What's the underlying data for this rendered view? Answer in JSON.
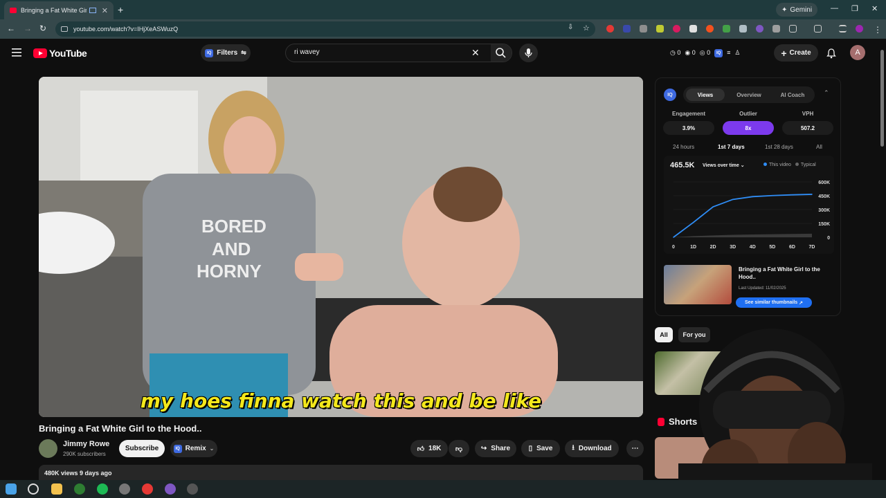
{
  "browser": {
    "tab_title": "Bringing a Fat White Girl to",
    "new_tab_icon": "plus-icon",
    "gemini_label": "Gemini",
    "url": "youtube.com/watch?v=IHjXeASWuzQ"
  },
  "youtube": {
    "logo_text": "YouTube",
    "filters_label": "Filters",
    "search_value": "ri wavey",
    "stats": [
      "0",
      "0",
      "0"
    ],
    "create_label": "Create",
    "avatar_letter": "A"
  },
  "video": {
    "caption": "my hoes finna watch this and be like",
    "title": "Bringing a Fat White Girl to the Hood..",
    "channel_name": "Jimmy Rowe",
    "subscribers": "290K subscribers",
    "subscribe_label": "Subscribe",
    "remix_label": "Remix",
    "likes": "18K",
    "share_label": "Share",
    "save_label": "Save",
    "download_label": "Download",
    "views_line": "480K views  9 days ago"
  },
  "iq_panel": {
    "logo_text": "IQ",
    "tabs": [
      "Views",
      "Overview",
      "AI Coach"
    ],
    "active_tab": "Views",
    "metrics": [
      {
        "label": "Engagement",
        "value": "3.9%"
      },
      {
        "label": "Outlier",
        "value": "8x"
      },
      {
        "label": "VPH",
        "value": "507.2"
      }
    ],
    "ranges": [
      "24 hours",
      "1st 7 days",
      "1st 28 days",
      "All"
    ],
    "active_range": "1st 7 days",
    "total_views": "465.5K",
    "chart_selector": "Views over time",
    "legend": [
      "This video",
      "Typical"
    ],
    "similar": {
      "title": "Bringing a Fat White Girl to the Hood..",
      "updated": "Last Updated: 11/02/2025",
      "button": "See similar thumbnails"
    }
  },
  "chart_data": {
    "type": "area",
    "x": [
      "0",
      "1D",
      "2D",
      "3D",
      "4D",
      "5D",
      "6D",
      "7D"
    ],
    "series": [
      {
        "name": "This video",
        "values": [
          0,
          160000,
          330000,
          410000,
          440000,
          452000,
          460000,
          465500
        ]
      },
      {
        "name": "Typical",
        "values": [
          0,
          12000,
          20000,
          26000,
          30000,
          33000,
          36000,
          38000
        ]
      }
    ],
    "y_ticks": [
      "0",
      "150K",
      "300K",
      "450K",
      "600K"
    ],
    "ylim": [
      0,
      600000
    ],
    "colors": {
      "this_video": "#2f8df6",
      "typical": "#555555"
    }
  },
  "sidebar": {
    "chips": [
      "All",
      "For you"
    ],
    "shorts_label": "Shorts"
  },
  "colors": {
    "accent": "#ff0033",
    "iq_blue": "#3e6ae1",
    "outlier_purple": "#7c3aed",
    "caption_yellow": "#f4e81b"
  }
}
